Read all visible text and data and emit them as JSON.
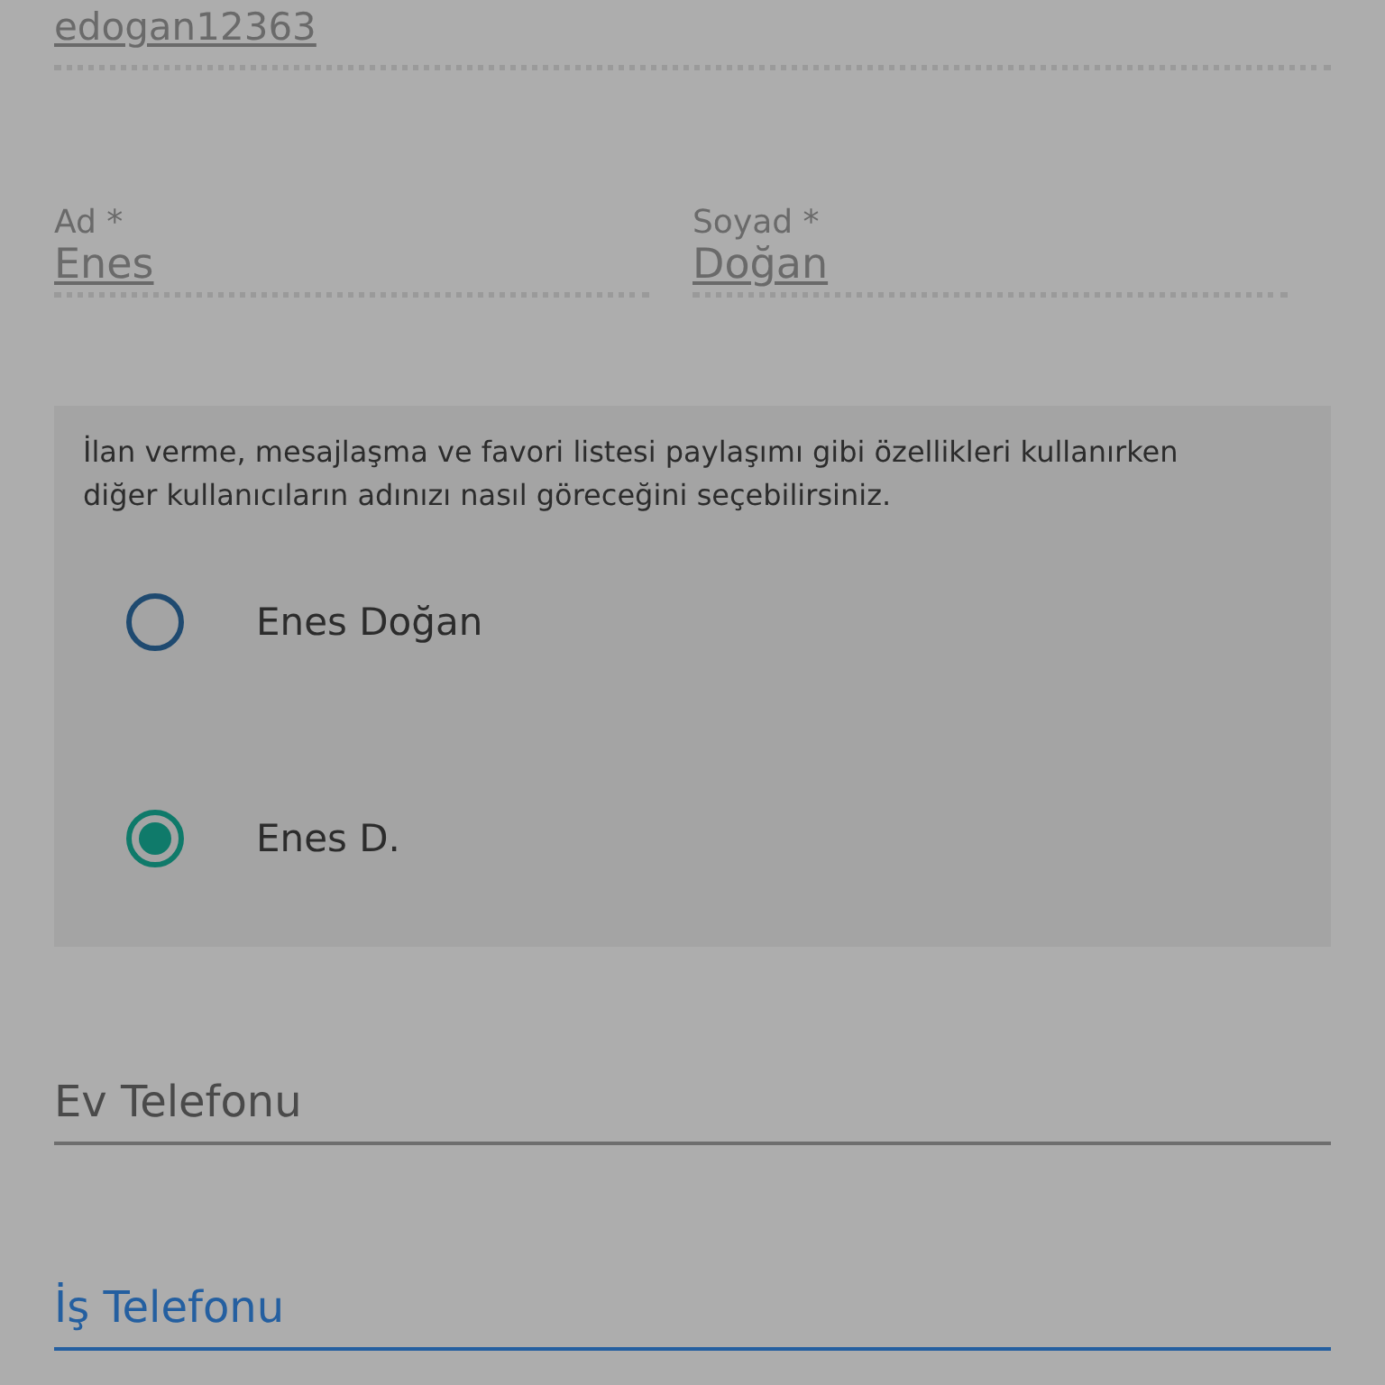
{
  "username_field": {
    "value": "edogan12363",
    "disabled": true
  },
  "name_fields": [
    {
      "label": "Ad *",
      "value": "Enes",
      "disabled": true
    },
    {
      "label": "Soyad *",
      "value": "Doğan",
      "disabled": true
    }
  ],
  "display_name": {
    "description": "İlan verme, mesajlaşma ve favori listesi paylaşımı gibi özellikleri kullanırken diğer kullanıcıların adınızı nasıl göreceğini seçebilirsiniz.",
    "options": [
      {
        "label": "Enes Doğan",
        "selected": false
      },
      {
        "label": "Enes D.",
        "selected": true
      }
    ]
  },
  "phone_fields": [
    {
      "placeholder": "Ev Telefonu",
      "focused": false
    },
    {
      "placeholder": "İş Telefonu",
      "focused": true
    }
  ]
}
